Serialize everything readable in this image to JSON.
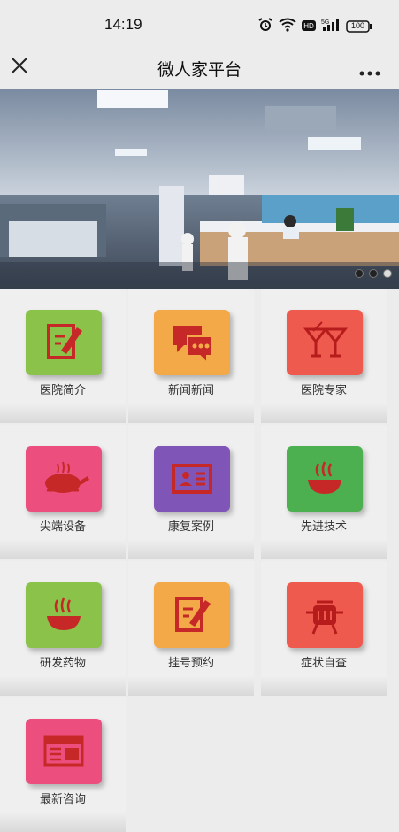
{
  "status": {
    "time": "14:19",
    "battery": "100"
  },
  "nav": {
    "title": "微人家平台"
  },
  "banner": {
    "icon": "hospital-lobby-photo",
    "dots": 3
  },
  "menu": [
    {
      "label": "医院简介",
      "icon": "edit-document-icon",
      "color": "#8bc34a"
    },
    {
      "label": "新闻新闻",
      "icon": "chat-bubbles-icon",
      "color": "#f4a949"
    },
    {
      "label": "医院专家",
      "icon": "cocktail-glasses-icon",
      "color": "#ef5a4f"
    },
    {
      "label": "尖端设备",
      "icon": "roast-chicken-icon",
      "color": "#ec4f7e"
    },
    {
      "label": "康复案例",
      "icon": "id-card-icon",
      "color": "#7f56b8"
    },
    {
      "label": "先进技术",
      "icon": "hot-bowl-icon",
      "color": "#4caf50"
    },
    {
      "label": "研发药物",
      "icon": "hot-bowl-icon",
      "color": "#8bc34a"
    },
    {
      "label": "挂号预约",
      "icon": "edit-document-icon",
      "color": "#f4a949"
    },
    {
      "label": "症状自查",
      "icon": "barbecue-grill-icon",
      "color": "#ef5a4f"
    },
    {
      "label": "最新咨询",
      "icon": "newspaper-icon",
      "color": "#ec4f7e"
    }
  ]
}
